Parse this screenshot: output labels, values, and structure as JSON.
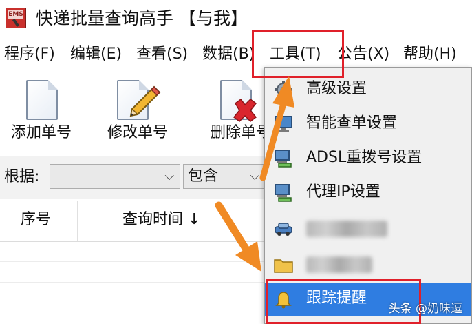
{
  "window": {
    "title": "快递批量查询高手 【与我】",
    "icon": "app-logo-icon"
  },
  "menubar": {
    "items": [
      {
        "label": "程序(F)"
      },
      {
        "label": "编辑(E)"
      },
      {
        "label": "查看(S)"
      },
      {
        "label": "数据(B)"
      },
      {
        "label": "工具(T)"
      },
      {
        "label": "公告(X)"
      },
      {
        "label": "帮助(H)"
      }
    ]
  },
  "toolbar": {
    "add_label": "添加单号",
    "edit_label": "修改单号",
    "delete_label": "删除单号"
  },
  "filter": {
    "label": "根据:",
    "field_value": "",
    "match_value": "包含"
  },
  "table": {
    "columns": [
      {
        "label": "序号"
      },
      {
        "label": "查询时间 ↓"
      }
    ]
  },
  "tools_menu": {
    "items": [
      {
        "label": "高级设置",
        "icon": "gear-icon"
      },
      {
        "label": "智能查单设置",
        "icon": "monitor-icon"
      },
      {
        "label": "ADSL重拨号设置",
        "icon": "network-computer-icon"
      },
      {
        "label": "代理IP设置",
        "icon": "network-computer-icon"
      },
      {
        "label": "",
        "icon": "car-icon",
        "blurred": true
      },
      {
        "label": "",
        "icon": "folder-icon",
        "blurred": true
      },
      {
        "label": "跟踪提醒",
        "icon": "bell-icon",
        "highlighted": true
      }
    ]
  },
  "watermark": {
    "text": "头条 @奶味逗"
  },
  "colors": {
    "highlight_blue": "#2f7de1",
    "annotation_red": "#e0202a",
    "annotation_orange": "#f08a24",
    "menu_bg": "#f0f0f0"
  }
}
